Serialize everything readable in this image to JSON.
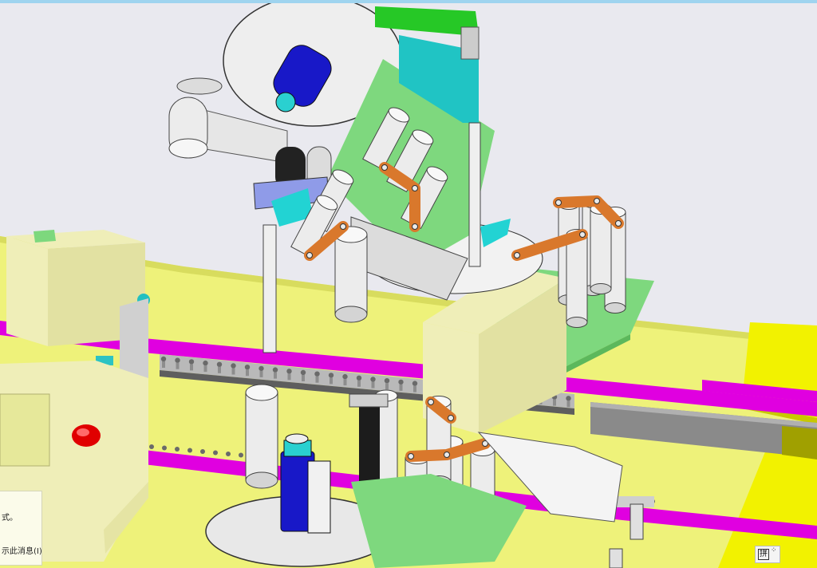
{
  "window": {
    "accent_color": "#9fd4ef"
  },
  "scene": {
    "colors": {
      "background": "#e9e9ef",
      "table_yellow": "#eef27a",
      "guard_yellow": "#f2f200",
      "conveyor_magenta": "#e000e0",
      "plate_green": "#7ed87e",
      "arm_orange": "#d9782c",
      "bracket_cyan": "#22d3d3",
      "handle_green": "#26c826",
      "bottle_blue": "#1818c8",
      "housing": "#efeeb8",
      "roller_grey": "#ececec",
      "estop_red": "#e00000"
    },
    "icons": [
      "emergency-stop-button-icon",
      "product-bottle-icon",
      "label-reel-icon"
    ]
  },
  "tooltip": {
    "line1": "式。",
    "line2": "示此消息(I)"
  },
  "ime": {
    "label": "拼",
    "icon": "ime-input-icon"
  }
}
